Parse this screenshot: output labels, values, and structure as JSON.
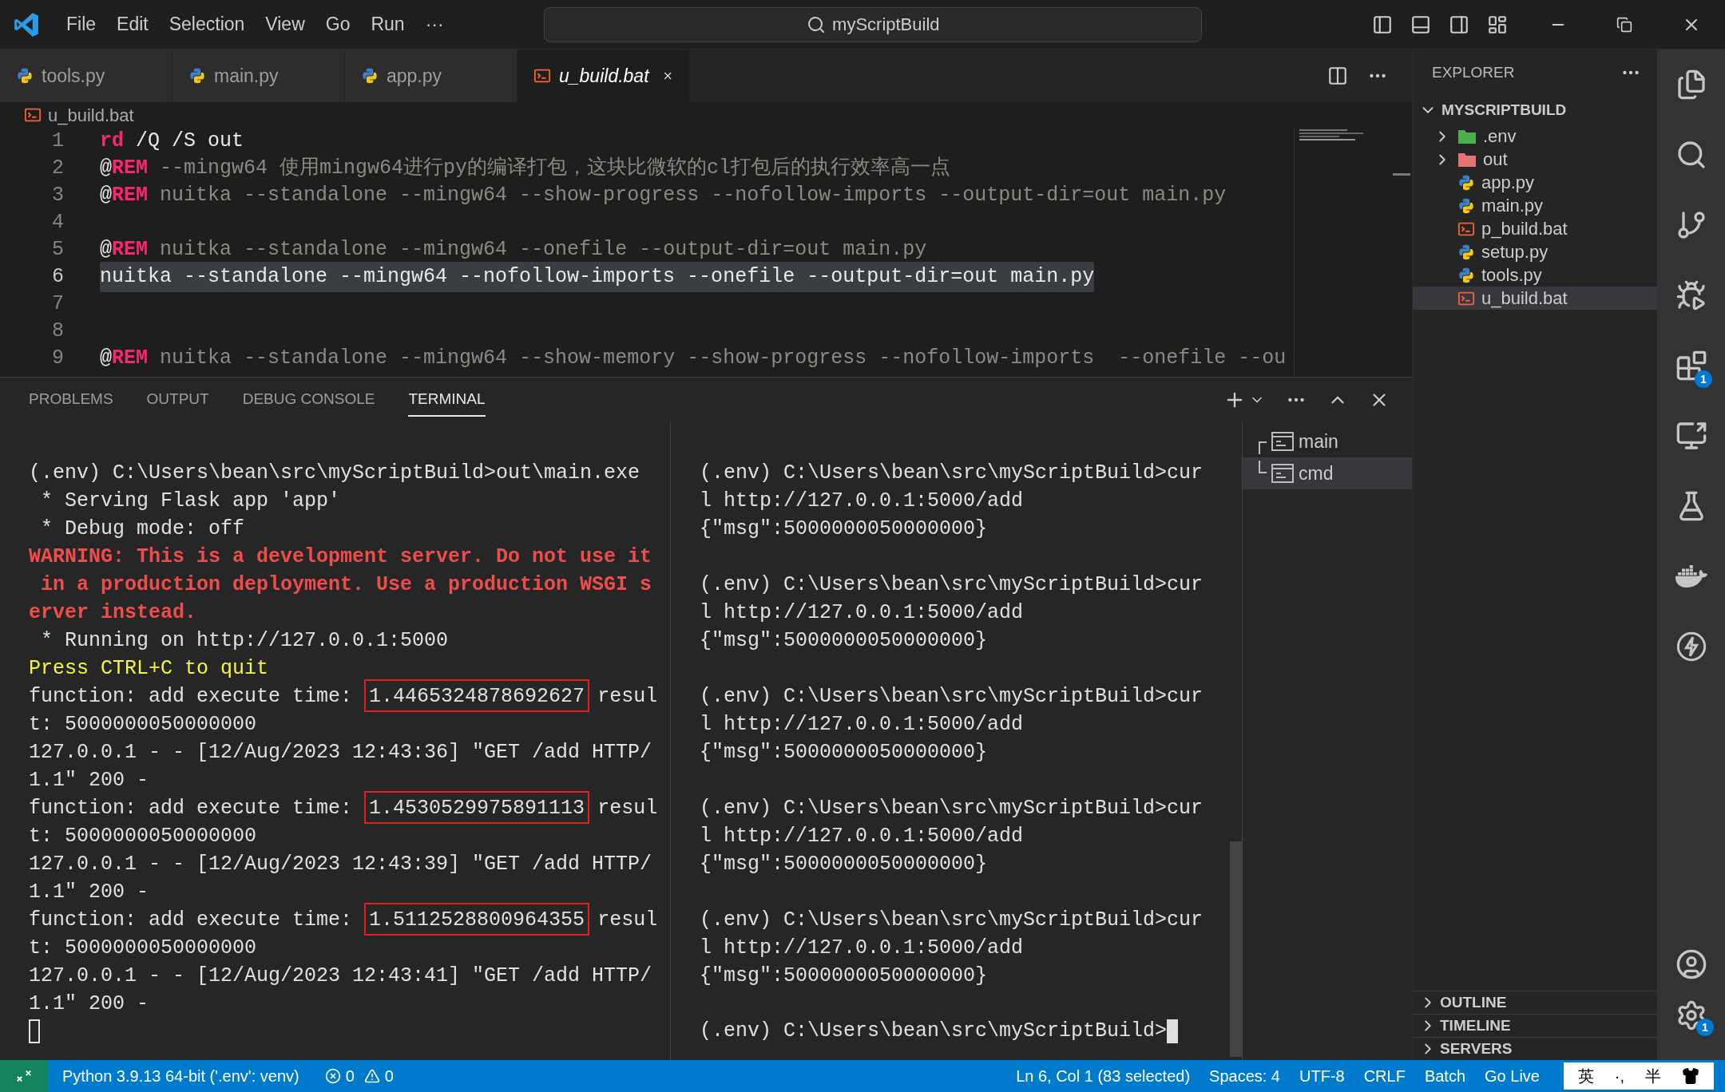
{
  "title_bar": {
    "menus": [
      "File",
      "Edit",
      "Selection",
      "View",
      "Go",
      "Run",
      "···"
    ],
    "command_center": "myScriptBuild"
  },
  "tabs": [
    {
      "label": "tools.py",
      "kind": "python",
      "selected": false
    },
    {
      "label": "main.py",
      "kind": "python",
      "selected": false
    },
    {
      "label": "app.py",
      "kind": "python",
      "selected": false
    },
    {
      "label": "u_build.bat",
      "kind": "batch",
      "selected": true
    }
  ],
  "breadcrumb": {
    "label": "u_build.bat",
    "kind": "batch"
  },
  "editor_lines": [
    {
      "number": "1",
      "selected": false,
      "tokens": [
        {
          "kind": "keyword",
          "text": "rd"
        },
        {
          "kind": "plain",
          "text": " /Q /S out"
        }
      ]
    },
    {
      "number": "2",
      "selected": false,
      "tokens": [
        {
          "kind": "plain",
          "text": "@"
        },
        {
          "kind": "keyword",
          "text": "REM"
        },
        {
          "kind": "comment",
          "text": " --mingw64 使用mingw64进行py的编译打包，这块比微软的cl打包后的执行效率高一点"
        }
      ]
    },
    {
      "number": "3",
      "selected": false,
      "tokens": [
        {
          "kind": "plain",
          "text": "@"
        },
        {
          "kind": "keyword",
          "text": "REM"
        },
        {
          "kind": "comment",
          "text": " nuitka --standalone --mingw64 --show-progress --nofollow-imports --output-dir=out main.py"
        }
      ]
    },
    {
      "number": "4",
      "selected": false
    },
    {
      "number": "5",
      "selected": false,
      "tokens": [
        {
          "kind": "plain",
          "text": "@"
        },
        {
          "kind": "keyword",
          "text": "REM"
        },
        {
          "kind": "comment",
          "text": " nuitka --standalone --mingw64 --onefile --output-dir=out main.py"
        }
      ]
    },
    {
      "number": "6",
      "selected": true,
      "tokens": [
        {
          "kind": "plain",
          "text": "nuitka --standalone --mingw64 --nofollow-imports --onefile --output-dir=out main.py"
        }
      ]
    },
    {
      "number": "7",
      "selected": false
    },
    {
      "number": "8",
      "selected": false
    },
    {
      "number": "9",
      "selected": false,
      "tokens": [
        {
          "kind": "plain",
          "text": "@"
        },
        {
          "kind": "keyword",
          "text": "REM"
        },
        {
          "kind": "comment",
          "text": " nuitka --standalone --mingw64 --show-memory --show-progress --nofollow-imports  --onefile --ou"
        }
      ]
    }
  ],
  "panel_tabs": [
    {
      "label": "PROBLEMS",
      "selected": false
    },
    {
      "label": "OUTPUT",
      "selected": false
    },
    {
      "label": "DEBUG CONSOLE",
      "selected": false
    },
    {
      "label": "TERMINAL",
      "selected": true
    }
  ],
  "terminal_left": [
    {
      "kind": "blank"
    },
    {
      "kind": "plain",
      "text": "(.env) C:\\Users\\bean\\src\\myScriptBuild>out\\main.exe"
    },
    {
      "kind": "plain",
      "text": " * Serving Flask app 'app'"
    },
    {
      "kind": "plain",
      "text": " * Debug mode: off"
    },
    {
      "kind": "warning",
      "text": "WARNING: This is a development server. Do not use it"
    },
    {
      "kind": "warning",
      "text": " in a production deployment. Use a production WSGI s"
    },
    {
      "kind": "warning",
      "text": "erver instead."
    },
    {
      "kind": "plain",
      "text": " * Running on http://127.0.0.1:5000"
    },
    {
      "kind": "notice",
      "text": "Press CTRL+C to quit"
    },
    {
      "kind": "timing",
      "prefix": "function: add execute time: ",
      "value": "1.4465324878692627",
      "suffix": "resul"
    },
    {
      "kind": "plain",
      "text": "t: 5000000050000000"
    },
    {
      "kind": "plain",
      "text": "127.0.0.1 - - [12/Aug/2023 12:43:36] \"GET /add HTTP/"
    },
    {
      "kind": "plain",
      "text": "1.1\" 200 -"
    },
    {
      "kind": "timing",
      "prefix": "function: add execute time: ",
      "value": "1.4530529975891113",
      "suffix": "resul"
    },
    {
      "kind": "plain",
      "text": "t: 5000000050000000"
    },
    {
      "kind": "plain",
      "text": "127.0.0.1 - - [12/Aug/2023 12:43:39] \"GET /add HTTP/"
    },
    {
      "kind": "plain",
      "text": "1.1\" 200 -"
    },
    {
      "kind": "timing",
      "prefix": "function: add execute time: ",
      "value": "1.5112528800964355",
      "suffix": "resul"
    },
    {
      "kind": "plain",
      "text": "t: 5000000050000000"
    },
    {
      "kind": "plain",
      "text": "127.0.0.1 - - [12/Aug/2023 12:43:41] \"GET /add HTTP/"
    },
    {
      "kind": "plain",
      "text": "1.1\" 200 -"
    },
    {
      "kind": "cursor"
    }
  ],
  "terminal_right": [
    {
      "kind": "blank"
    },
    {
      "kind": "plain",
      "text": "(.env) C:\\Users\\bean\\src\\myScriptBuild>cur"
    },
    {
      "kind": "plain",
      "text": "l http://127.0.0.1:5000/add"
    },
    {
      "kind": "plain",
      "text": "{\"msg\":5000000050000000}"
    },
    {
      "kind": "blank"
    },
    {
      "kind": "plain",
      "text": "(.env) C:\\Users\\bean\\src\\myScriptBuild>cur"
    },
    {
      "kind": "plain",
      "text": "l http://127.0.0.1:5000/add"
    },
    {
      "kind": "plain",
      "text": "{\"msg\":5000000050000000}"
    },
    {
      "kind": "blank"
    },
    {
      "kind": "plain",
      "text": "(.env) C:\\Users\\bean\\src\\myScriptBuild>cur"
    },
    {
      "kind": "plain",
      "text": "l http://127.0.0.1:5000/add"
    },
    {
      "kind": "plain",
      "text": "{\"msg\":5000000050000000}"
    },
    {
      "kind": "blank"
    },
    {
      "kind": "plain",
      "text": "(.env) C:\\Users\\bean\\src\\myScriptBuild>cur"
    },
    {
      "kind": "plain",
      "text": "l http://127.0.0.1:5000/add"
    },
    {
      "kind": "plain",
      "text": "{\"msg\":5000000050000000}"
    },
    {
      "kind": "blank"
    },
    {
      "kind": "plain",
      "text": "(.env) C:\\Users\\bean\\src\\myScriptBuild>cur"
    },
    {
      "kind": "plain",
      "text": "l http://127.0.0.1:5000/add"
    },
    {
      "kind": "plain",
      "text": "{\"msg\":5000000050000000}"
    },
    {
      "kind": "blank"
    },
    {
      "kind": "prompt",
      "text": "(.env) C:\\Users\\bean\\src\\myScriptBuild>"
    }
  ],
  "terminals": [
    {
      "label": "main",
      "selected": false
    },
    {
      "label": "cmd",
      "selected": true
    }
  ],
  "explorer": {
    "title": "EXPLORER",
    "root": {
      "label": "MYSCRIPTBUILD",
      "expanded": true
    },
    "items": [
      {
        "label": ".env",
        "kind": "folder",
        "expanded": false,
        "color": "#4caf50",
        "selected": false
      },
      {
        "label": "out",
        "kind": "folder",
        "expanded": false,
        "color": "#e57373",
        "selected": false
      },
      {
        "label": "app.py",
        "kind": "python",
        "selected": false
      },
      {
        "label": "main.py",
        "kind": "python",
        "selected": false
      },
      {
        "label": "p_build.bat",
        "kind": "batch",
        "selected": false
      },
      {
        "label": "setup.py",
        "kind": "python",
        "selected": false
      },
      {
        "label": "tools.py",
        "kind": "python",
        "selected": false
      },
      {
        "label": "u_build.bat",
        "kind": "batch",
        "selected": true
      }
    ],
    "sections": [
      {
        "label": "OUTLINE",
        "expanded": false
      },
      {
        "label": "TIMELINE",
        "expanded": false
      },
      {
        "label": "SERVERS",
        "expanded": false
      }
    ]
  },
  "activity_bar": {
    "extensions_badge": "1",
    "settings_badge": "1"
  },
  "status_bar": {
    "interpreter": "Python 3.9.13 64-bit ('.env': venv)",
    "errors": "0",
    "warnings": "0",
    "right": [
      "Ln 6, Col 1 (83 selected)",
      "Spaces: 4",
      "UTF-8",
      "CRLF",
      "Batch",
      "Go Live"
    ]
  },
  "ime_bar": [
    "英",
    "·,",
    "半"
  ]
}
